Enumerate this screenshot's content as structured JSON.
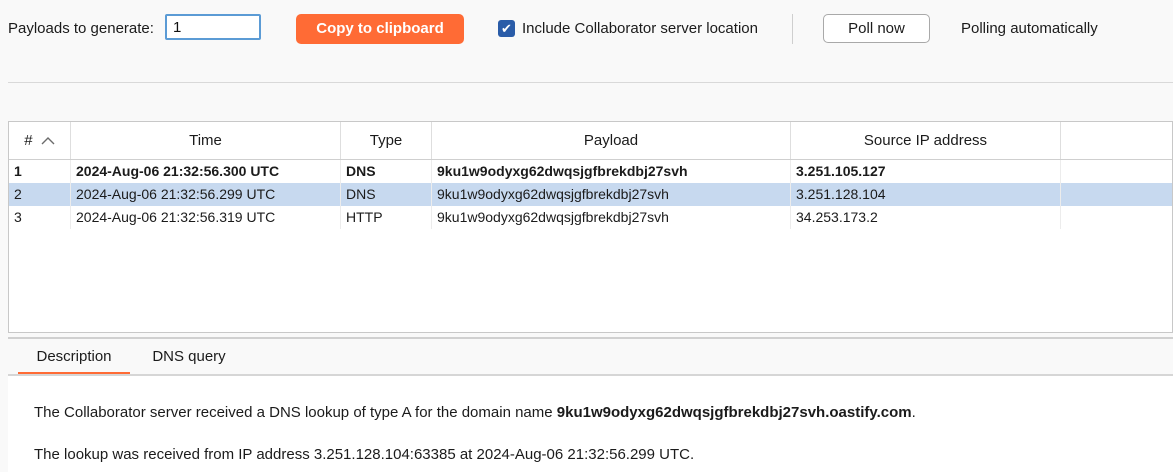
{
  "toolbar": {
    "payloads_label": "Payloads to generate:",
    "payloads_value": "1",
    "copy_button": "Copy to clipboard",
    "include_location_label": "Include Collaborator server location",
    "include_location_checked": true,
    "poll_button": "Poll now",
    "polling_status": "Polling automatically"
  },
  "table": {
    "headers": [
      "#",
      "Time",
      "Type",
      "Payload",
      "Source IP address"
    ],
    "rows": [
      {
        "num": "1",
        "time": "2024-Aug-06 21:32:56.300 UTC",
        "type": "DNS",
        "payload": "9ku1w9odyxg62dwqsjgfbrekdbj27svh",
        "ip": "3.251.105.127"
      },
      {
        "num": "2",
        "time": "2024-Aug-06 21:32:56.299 UTC",
        "type": "DNS",
        "payload": "9ku1w9odyxg62dwqsjgfbrekdbj27svh",
        "ip": "3.251.128.104"
      },
      {
        "num": "3",
        "time": "2024-Aug-06 21:32:56.319 UTC",
        "type": "HTTP",
        "payload": "9ku1w9odyxg62dwqsjgfbrekdbj27svh",
        "ip": "34.253.173.2"
      }
    ]
  },
  "details": {
    "tabs": [
      "Description",
      "DNS query"
    ],
    "line1_prefix": "The Collaborator server received a DNS lookup of type A for the domain name ",
    "line1_domain": "9ku1w9odyxg62dwqsjgfbrekdbj27svh.oastify.com",
    "line1_suffix": ".",
    "line2": "The lookup was received from IP address 3.251.128.104:63385 at 2024-Aug-06 21:32:56.299 UTC."
  },
  "colors": {
    "accent": "#ff6b35",
    "selected_row": "#c7d9ef",
    "checkbox": "#2a5ca8"
  },
  "icons": {
    "sort": "chevron-up-icon",
    "check": "checkmark-icon"
  }
}
